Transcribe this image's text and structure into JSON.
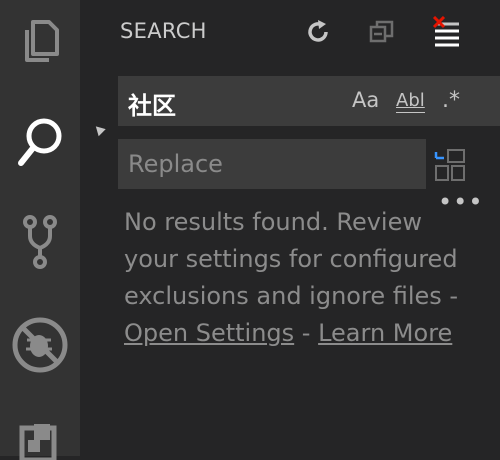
{
  "activity_bar": {
    "items": [
      {
        "icon": "files-icon",
        "active": false
      },
      {
        "icon": "search-icon",
        "active": true
      },
      {
        "icon": "source-control-icon",
        "active": false
      },
      {
        "icon": "debug-icon",
        "active": false
      },
      {
        "icon": "extensions-icon",
        "active": false
      }
    ]
  },
  "panel": {
    "title": "SEARCH",
    "toolbar": {
      "refresh_icon": "refresh-icon",
      "collapse_icon": "collapse-all-icon",
      "clear_icon": "clear-results-icon"
    }
  },
  "search": {
    "value": "社区",
    "options": {
      "match_case": "Aa",
      "whole_word": "Abl",
      "regex": ".*"
    }
  },
  "replace": {
    "placeholder": "Replace",
    "replace_all_icon": "replace-all-icon"
  },
  "more_options": "•••",
  "message": {
    "text": "No results found. Review your settings for configured exclusions and ignore files - ",
    "open_settings_link": "Open Settings",
    "separator": " - ",
    "learn_more_link": "Learn More"
  },
  "colors": {
    "background": "#252526",
    "activity_bar": "#333333",
    "input": "#3c3c3c",
    "text": "#cccccc",
    "muted": "#8c8c8c"
  }
}
